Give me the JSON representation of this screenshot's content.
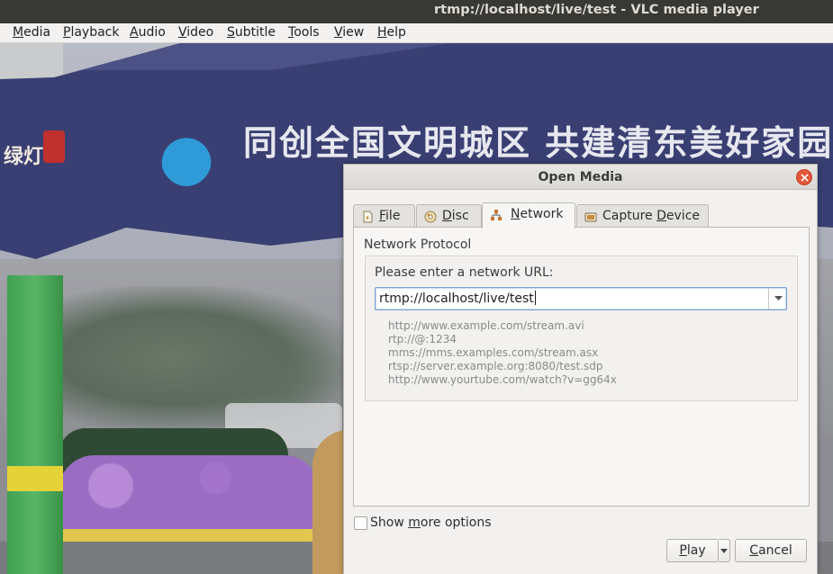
{
  "window": {
    "title": "rtmp://localhost/live/test - VLC media player"
  },
  "menubar": {
    "items": [
      {
        "label": "Media",
        "mnemonic": "M",
        "rest": "edia"
      },
      {
        "label": "Playback",
        "mnemonic": "P",
        "rest": "layback"
      },
      {
        "label": "Audio",
        "mnemonic": "A",
        "rest": "udio"
      },
      {
        "label": "Video",
        "mnemonic": "V",
        "rest": "ideo"
      },
      {
        "label": "Subtitle",
        "mnemonic": "S",
        "rest": "ubtitle"
      },
      {
        "label": "Tools",
        "mnemonic": "T",
        "rest": "ools"
      },
      {
        "label": "View",
        "mnemonic": "V",
        "rest": "iew"
      },
      {
        "label": "Help",
        "mnemonic": "H",
        "rest": "elp"
      }
    ]
  },
  "video_overlay": {
    "sign_text": "同创全国文明城区  共建清东美好家园",
    "sign_left_text": "绿灯"
  },
  "dialog": {
    "title": "Open Media",
    "tabs": [
      {
        "label": "File",
        "mnemonic": "F",
        "rest": "ile",
        "icon": "file-icon"
      },
      {
        "label": "Disc",
        "mnemonic": "D",
        "rest": "isc",
        "icon": "disc-icon"
      },
      {
        "label": "Network",
        "mnemonic": "N",
        "rest": "etwork",
        "icon": "network-icon",
        "active": true
      },
      {
        "label": "Capture Device",
        "mnemonic": "D",
        "pre": "Capture ",
        "rest": "evice",
        "icon": "capture-device-icon"
      }
    ],
    "network": {
      "section_title": "Network Protocol",
      "url_label": "Please enter a network URL:",
      "url_value": "rtmp://localhost/live/test",
      "examples": [
        "http://www.example.com/stream.avi",
        "rtp://@:1234",
        "mms://mms.examples.com/stream.asx",
        "rtsp://server.example.org:8080/test.sdp",
        "http://www.yourtube.com/watch?v=gg64x"
      ]
    },
    "show_more_options": {
      "label": "Show more options",
      "pre": "Show ",
      "mnemonic": "m",
      "rest": "ore options",
      "checked": false
    },
    "buttons": {
      "play": {
        "label": "Play",
        "mnemonic": "P",
        "rest": "lay"
      },
      "cancel": {
        "label": "Cancel",
        "mnemonic": "C",
        "rest": "ancel"
      }
    }
  }
}
